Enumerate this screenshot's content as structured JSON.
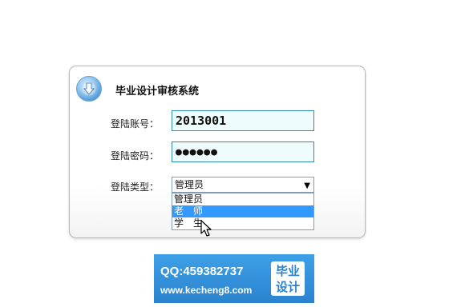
{
  "header": {
    "title": "毕业设计审核系统",
    "icon": "download-arrow-icon"
  },
  "form": {
    "account_label": "登陆账号：",
    "account_value": "2013001",
    "password_label": "登陆密码：",
    "password_value": "●●●●●●",
    "type_label": "登陆类型：",
    "type_selected": "管理员",
    "type_options": [
      "管理员",
      "老　师",
      "学　生"
    ],
    "highlighted_option_index": 1
  },
  "banner": {
    "qq": "QQ:459382737",
    "site": "www.kecheng8.com",
    "badge_line1": "毕业",
    "badge_line2": "设计"
  },
  "colors": {
    "field_border": "#2e8bb1",
    "field_bg": "#eefcfd",
    "selection": "#3399ff",
    "banner": "#2b83cf"
  }
}
